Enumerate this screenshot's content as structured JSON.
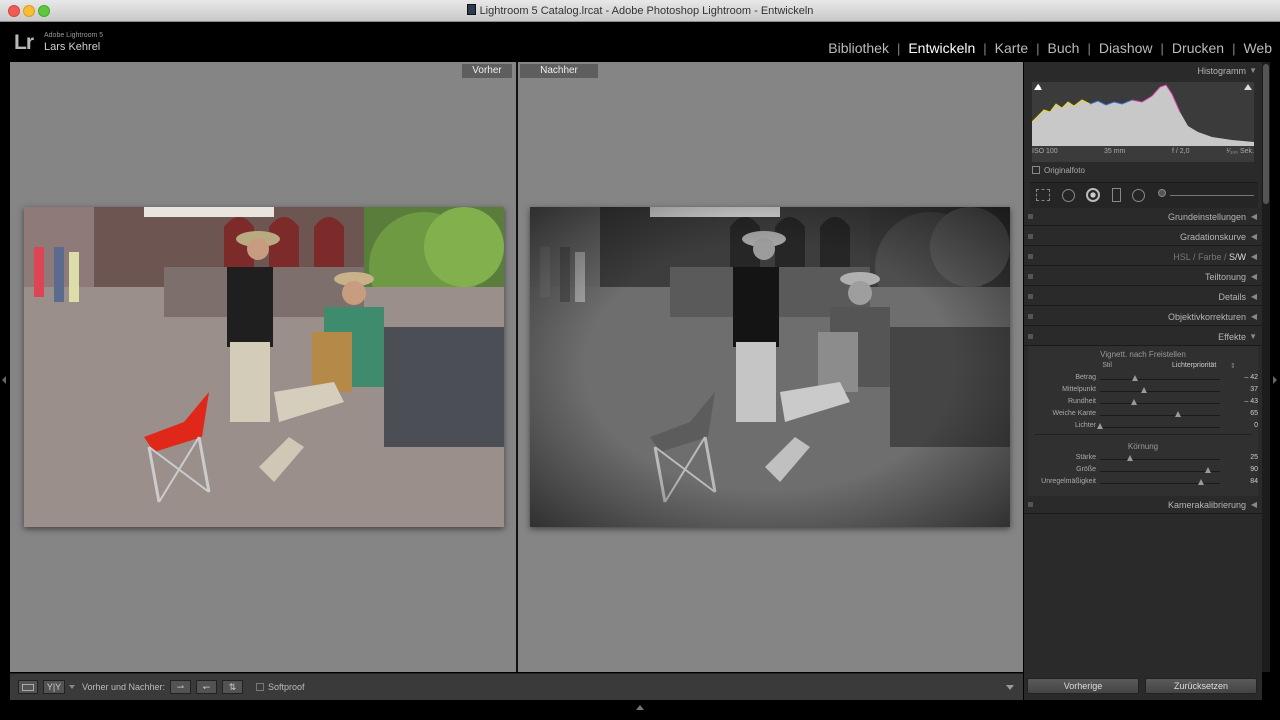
{
  "window": {
    "title": "Lightroom 5 Catalog.lrcat - Adobe Photoshop Lightroom - Entwickeln"
  },
  "identity": {
    "app": "Adobe Lightroom 5",
    "user": "Lars Kehrel",
    "logo": "Lr"
  },
  "modules": [
    "Bibliothek",
    "Entwickeln",
    "Karte",
    "Buch",
    "Diashow",
    "Drucken",
    "Web"
  ],
  "active_module": "Entwickeln",
  "views": {
    "before": "Vorher",
    "after": "Nachher"
  },
  "histogram": {
    "title": "Histogramm",
    "iso": "ISO 100",
    "focal": "35 mm",
    "aperture": "f / 2,0",
    "shutter": "¹⁄₁₀₀ Sek.",
    "original_label": "Originalfoto"
  },
  "panels": {
    "basic": "Grundeinstellungen",
    "tone_curve": "Gradationskurve",
    "hsl_a": "HSL",
    "hsl_b": "Farbe",
    "hsl_c": "S/W",
    "split": "Teiltonung",
    "details": "Details",
    "lens": "Objektivkorrekturen",
    "effects": "Effekte",
    "calibration": "Kamerakalibrierung"
  },
  "vignette": {
    "title": "Vignett. nach Freistellen",
    "style_label": "Stil",
    "style_value": "Lichterpriorität",
    "sliders": [
      {
        "label": "Betrag",
        "value": "– 42",
        "frac": 0.29
      },
      {
        "label": "Mittelpunkt",
        "value": "37",
        "frac": 0.37
      },
      {
        "label": "Rundheit",
        "value": "– 43",
        "frac": 0.28
      },
      {
        "label": "Weiche Kante",
        "value": "65",
        "frac": 0.65
      },
      {
        "label": "Lichter",
        "value": "0",
        "frac": 0.0
      }
    ]
  },
  "grain": {
    "title": "Körnung",
    "sliders": [
      {
        "label": "Stärke",
        "value": "25",
        "frac": 0.25
      },
      {
        "label": "Größe",
        "value": "90",
        "frac": 0.9
      },
      {
        "label": "Unregelmäßigkeit",
        "value": "84",
        "frac": 0.84
      }
    ]
  },
  "toolbar": {
    "compare_label": "Vorher und Nachher:",
    "softproof": "Softproof",
    "view_icon_yy": "Y|Y"
  },
  "buttons": {
    "previous": "Vorherige",
    "reset": "Zurücksetzen"
  }
}
